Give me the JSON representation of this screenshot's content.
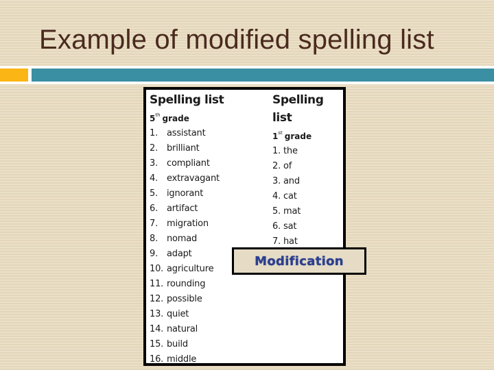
{
  "slide": {
    "title": "Example of modified spelling list",
    "colors": {
      "title_text": "#4a2a1e",
      "accent_orange": "#fbb514",
      "accent_teal": "#3a8fa2",
      "modification_text": "#2b3f8f"
    }
  },
  "lists": {
    "fifth_grade": {
      "title": "Spelling list",
      "grade_number": "5",
      "grade_suffix": "th",
      "grade_label": "grade",
      "items": [
        {
          "num": "1.",
          "word": "assistant"
        },
        {
          "num": "2.",
          "word": "brilliant"
        },
        {
          "num": "3.",
          "word": "compliant"
        },
        {
          "num": "4.",
          "word": "extravagant"
        },
        {
          "num": "5.",
          "word": "ignorant"
        },
        {
          "num": "6.",
          "word": "artifact"
        },
        {
          "num": "7.",
          "word": "migration"
        },
        {
          "num": "8.",
          "word": "nomad"
        },
        {
          "num": "9.",
          "word": "adapt"
        },
        {
          "num": "10.",
          "word": "agriculture"
        },
        {
          "num": "11.",
          "word": "rounding"
        },
        {
          "num": "12.",
          "word": "possible"
        },
        {
          "num": "13.",
          "word": "quiet"
        },
        {
          "num": "14.",
          "word": "natural"
        },
        {
          "num": "15.",
          "word": "build"
        },
        {
          "num": "16.",
          "word": "middle"
        }
      ]
    },
    "first_grade": {
      "title": "Spelling list",
      "grade_number": "1",
      "grade_suffix": "st",
      "grade_label": "grade",
      "items": [
        {
          "num": "1.",
          "word": "the"
        },
        {
          "num": "2.",
          "word": "of"
        },
        {
          "num": "3.",
          "word": "and"
        },
        {
          "num": "4.",
          "word": "cat"
        },
        {
          "num": "5.",
          "word": "mat"
        },
        {
          "num": "6.",
          "word": "sat"
        },
        {
          "num": "7.",
          "word": "hat"
        }
      ]
    }
  },
  "callout": {
    "label": "Modification"
  }
}
